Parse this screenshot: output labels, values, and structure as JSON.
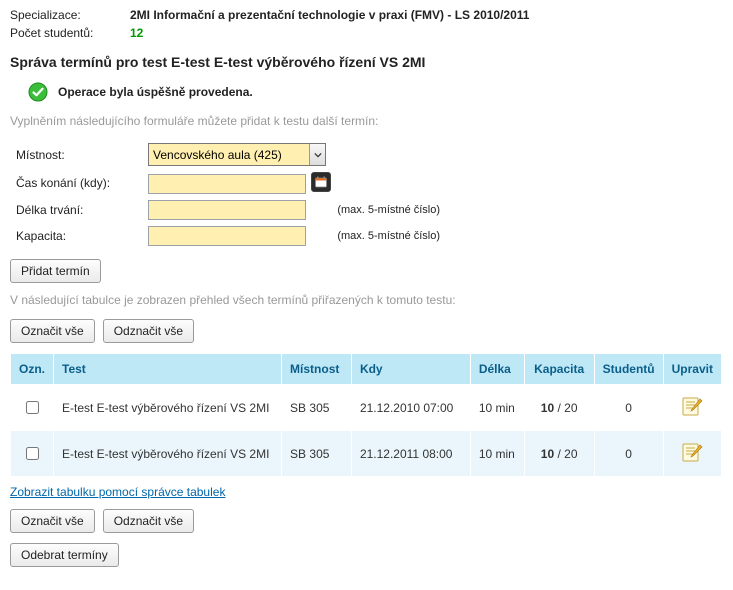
{
  "header": {
    "spec_label": "Specializace:",
    "spec_value": "2MI Informační a prezentační technologie v praxi (FMV) - LS 2010/2011",
    "students_label": "Počet studentů:",
    "students_value": "12"
  },
  "title": "Správa termínů pro test E-test E-test výběrového řízení VS 2MI",
  "success_message": "Operace byla úspěšně provedena.",
  "form": {
    "intro": "Vyplněním následujícího formuláře můžete přidat k testu další termín:",
    "room_label": "Místnost:",
    "room_selected": "Vencovského aula (425)",
    "time_label": "Čas konání (kdy):",
    "time_value": "",
    "duration_label": "Délka trvání:",
    "duration_value": "",
    "duration_hint": "(max. 5-místné číslo)",
    "capacity_label": "Kapacita:",
    "capacity_value": "",
    "capacity_hint": "(max. 5-místné číslo)",
    "submit_label": "Přidat termín"
  },
  "list": {
    "intro": "V následující tabulce je zobrazen přehled všech termínů přiřazených k tomuto testu:",
    "select_all": "Označit vše",
    "deselect_all": "Odznačit vše",
    "headers": {
      "mark": "Ozn.",
      "test": "Test",
      "room": "Místnost",
      "when": "Kdy",
      "duration": "Délka",
      "capacity": "Kapacita",
      "students": "Studentů",
      "edit": "Upravit"
    },
    "rows": [
      {
        "test": "E-test E-test výběrového řízení VS 2MI",
        "room": "SB 305",
        "when": "21.12.2010 07:00",
        "duration": "10 min",
        "capacity_used": "10",
        "capacity_total": " / 20",
        "students": "0"
      },
      {
        "test": "E-test E-test výběrového řízení VS 2MI",
        "room": "SB 305",
        "when": "21.12.2011 08:00",
        "duration": "10 min",
        "capacity_used": "10",
        "capacity_total": " / 20",
        "students": "0"
      }
    ],
    "show_via_manager": "Zobrazit tabulku pomocí správce tabulek",
    "remove_label": "Odebrat termíny"
  }
}
